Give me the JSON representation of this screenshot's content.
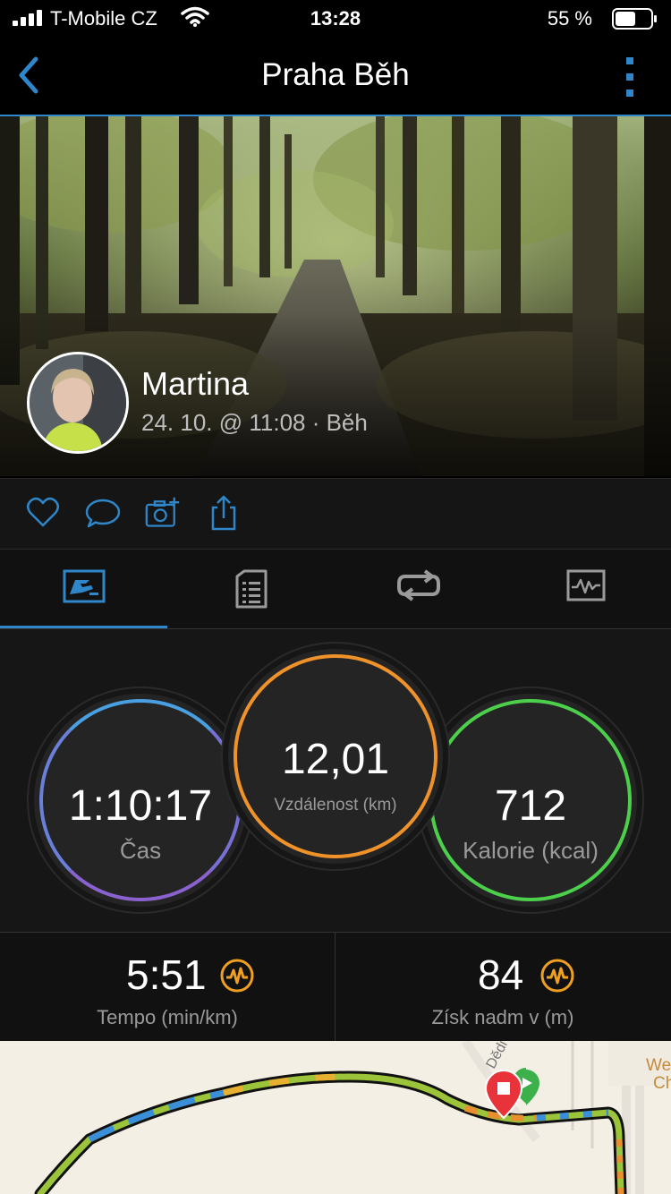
{
  "status_bar": {
    "carrier": "T-Mobile CZ",
    "time": "13:28",
    "battery": "55 %"
  },
  "nav": {
    "title": "Praha Běh"
  },
  "activity": {
    "user_name": "Martina",
    "meta": "24. 10. @ 11:08 · Běh"
  },
  "tabs": [
    "overview",
    "details",
    "laps",
    "charts"
  ],
  "active_tab": 0,
  "stats": {
    "time": {
      "value": "1:10:17",
      "label": "Čas",
      "color_top": "#4a9fe0",
      "color_bottom": "#8a62d0"
    },
    "distance": {
      "value": "12,01",
      "label": "Vzdálenost (km)",
      "color": "#f0922a"
    },
    "calories": {
      "value": "712",
      "label": "Kalorie (kcal)",
      "color": "#4ccf4a"
    }
  },
  "metrics": {
    "pace": {
      "value": "5:51",
      "label": "Tempo (min/km)"
    },
    "elevation": {
      "value": "84",
      "label": "Získ nadm v (m)"
    }
  },
  "map": {
    "street_label": "Dědi",
    "place_label_1": "We",
    "place_label_2": "Ch"
  },
  "colors": {
    "accent": "#2f86c9",
    "chart_icon": "#f0a020",
    "end_marker": "#e8333a",
    "start_marker": "#3cb04a"
  }
}
